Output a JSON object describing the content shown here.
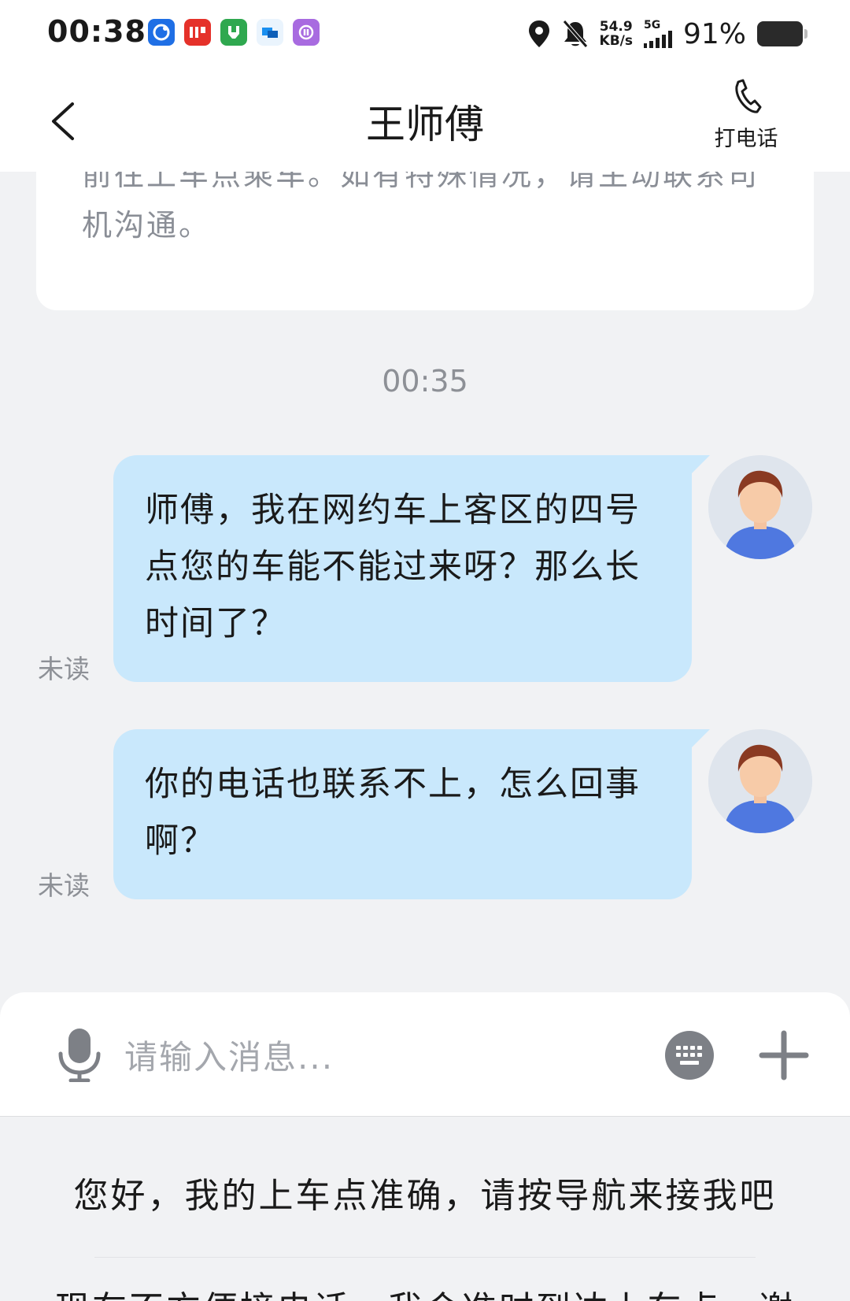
{
  "status_bar": {
    "time": "00:38",
    "net_speed_value": "54.9",
    "net_speed_unit": "KB/s",
    "network_type": "5G",
    "battery_percent": "91%",
    "app_icons": [
      {
        "name": "browser-app-icon",
        "color": "#1f6fe5"
      },
      {
        "name": "dianping-app-icon",
        "color": "#e5312a"
      },
      {
        "name": "meituan-app-icon",
        "color": "#2fa84f"
      },
      {
        "name": "message-app-icon",
        "color": "#1a8ff0"
      },
      {
        "name": "purple-app-icon",
        "color": "#a86be0"
      }
    ]
  },
  "header": {
    "title": "王师傅",
    "call_label": "打电话"
  },
  "notice": {
    "text": "前往上车点乘车。如有特殊情况，请主动联系司机沟通。"
  },
  "timestamp": "00:35",
  "messages": [
    {
      "text": "师傅，我在网约车上客区的四号点您的车能不能过来呀？那么长时间了？",
      "status": "未读"
    },
    {
      "text": "你的电话也联系不上，怎么回事啊？",
      "status": "未读"
    }
  ],
  "input": {
    "placeholder": "请输入消息..."
  },
  "quick_replies": [
    "您好，我的上车点准确，请按导航来接我吧",
    "现在不方便接电话，我会准时到达上车点，谢"
  ],
  "colors": {
    "bubble": "#c9e8fc",
    "background": "#f1f2f4",
    "accent_blue": "#3a78f0"
  }
}
